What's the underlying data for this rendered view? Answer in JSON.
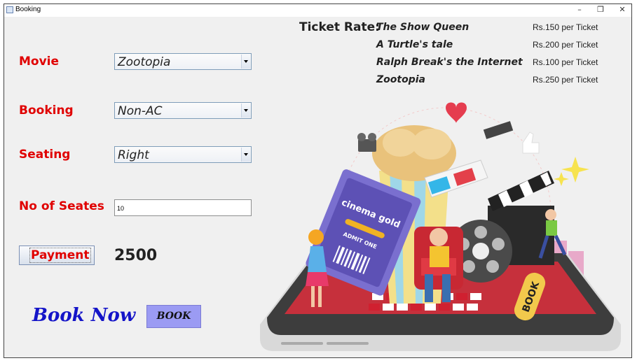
{
  "window": {
    "title": "Booking",
    "minimize": "–",
    "restore": "❐",
    "close": "✕"
  },
  "form": {
    "movie_label": "Movie",
    "movie_value": "Zootopia",
    "booking_label": "Booking",
    "booking_value": "Non-AC",
    "seating_label": "Seating",
    "seating_value": "Right",
    "seats_label": "No of Seates",
    "seats_value": "10",
    "payment_label": "Payment",
    "amount": "2500",
    "book_now_label": "Book Now",
    "book_button_label": "BOOK"
  },
  "rates": {
    "title": "Ticket Rate:",
    "items": [
      {
        "movie": "The Show Queen",
        "price": "Rs.150 per Ticket"
      },
      {
        "movie": "A Turtle's tale",
        "price": "Rs.200 per Ticket"
      },
      {
        "movie": "Ralph Break's the Internet",
        "price": "Rs.100 per Ticket"
      },
      {
        "movie": "Zootopia",
        "price": "Rs.250 per Ticket"
      }
    ]
  },
  "illustration": {
    "ticket_logo": "cinema gold",
    "ticket_text": "ADMIT ONE",
    "phone_button": "BOOK"
  },
  "colors": {
    "label_red": "#e00000",
    "book_now_blue": "#1414c8",
    "book_button_bg": "#9b9bf3"
  }
}
